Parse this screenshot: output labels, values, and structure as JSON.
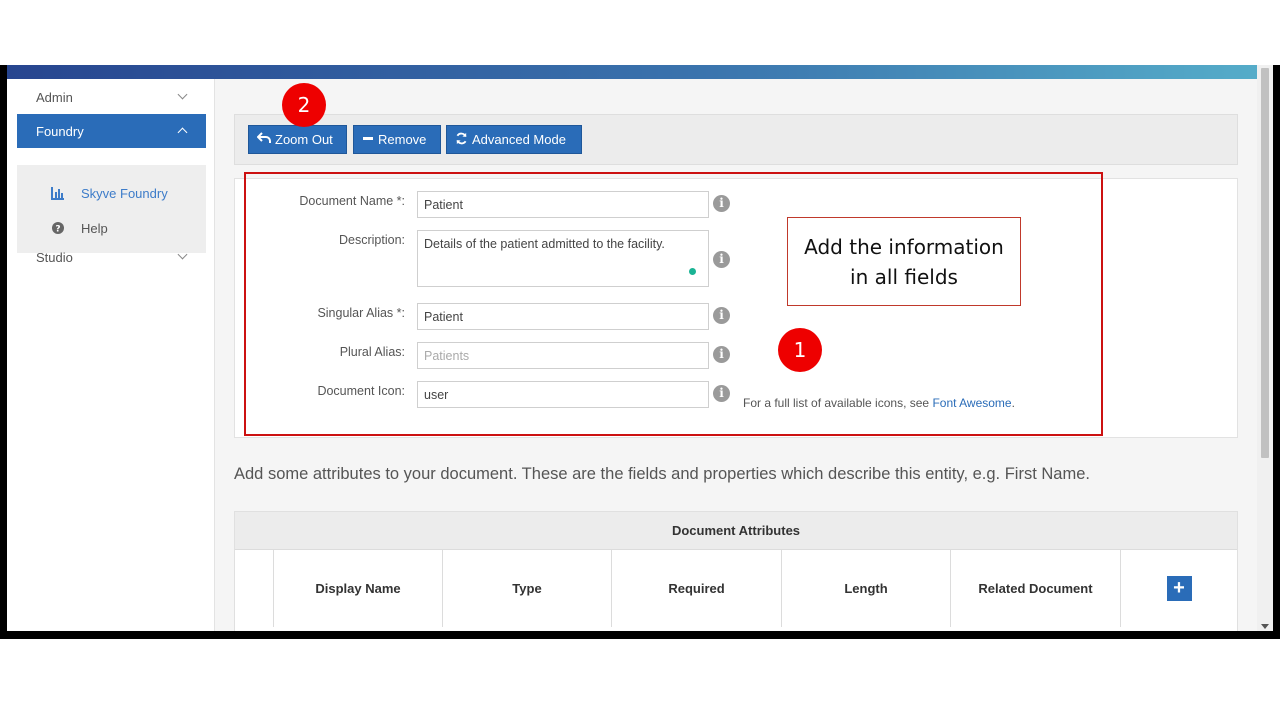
{
  "sidebar": {
    "items": [
      {
        "label": "Admin"
      },
      {
        "label": "Foundry"
      },
      {
        "label": "Studio"
      }
    ],
    "sub_items": [
      {
        "label": "Skyve Foundry",
        "icon": "bar-chart-icon"
      },
      {
        "label": "Help",
        "icon": "question-circle-icon"
      }
    ]
  },
  "toolbar": {
    "zoom_out": "Zoom Out",
    "remove": "Remove",
    "advanced": "Advanced Mode"
  },
  "form": {
    "document_name_label": "Document Name *:",
    "document_name_value": "Patient",
    "description_label": "Description:",
    "description_value": "Details of the patient admitted to the facility.",
    "singular_alias_label": "Singular Alias *:",
    "singular_alias_value": "Patient",
    "plural_alias_label": "Plural Alias:",
    "plural_alias_placeholder": "Patients",
    "document_icon_label": "Document Icon:",
    "document_icon_value": "user",
    "icon_hint_prefix": "For a full list of available icons, see",
    "icon_hint_link": "Font Awesome",
    "icon_hint_suffix": "."
  },
  "annotations": {
    "callout_line1": "Add the information",
    "callout_line2": "in all fields",
    "badge_1": "1",
    "badge_2": "2",
    "badge_color": "#ee0000"
  },
  "attributes": {
    "intro": "Add some attributes to your document. These are the fields and properties which describe this entity, e.g. First Name.",
    "title": "Document Attributes",
    "columns": [
      "Display Name",
      "Type",
      "Required",
      "Length",
      "Related Document"
    ],
    "add_label": "+"
  },
  "colors": {
    "primary": "#2a6cb8",
    "accent_dot": "#1ab394",
    "highlight_border": "#cc1111"
  }
}
